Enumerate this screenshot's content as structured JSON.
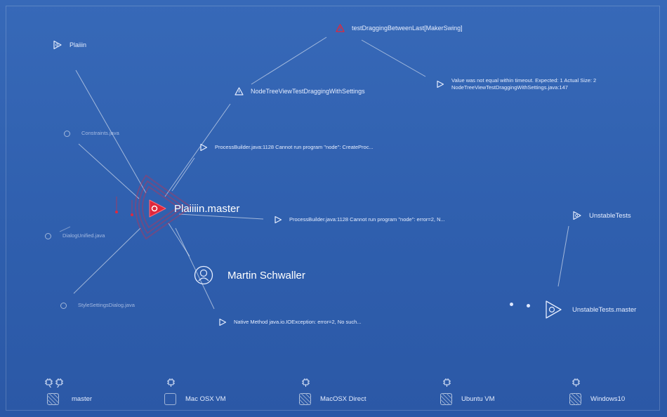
{
  "graph": {
    "nodes": {
      "plaiiiin": "Plaiiin",
      "constraints": "Constraints.java",
      "dialog_unified": "DialogUnified.java",
      "style_settings": "StyleSettingsDialog.java",
      "test_dragging_last": "testDraggingBetweenLast[MakerSwing]",
      "nodetree_settings": "NodeTreeViewTestDraggingWithSettings",
      "value_not_equal_1": "Value was not equal within timeout. Expected: 1 Actual Size:  2",
      "value_not_equal_2": "NodeTreeViewTestDraggingWithSettings.java:147",
      "processbuilder_1": "ProcessBuilder.java:1128 Cannot run program \"node\": CreateProc...",
      "master": "Plaiiiin.master",
      "processbuilder_2": "ProcessBuilder.java:1128 Cannot run program \"node\": error=2, N...",
      "user": "Martin Schwaller",
      "native_method": "Native Method java.io.IOException: error=2, No such...",
      "unstable_tests": "UnstableTests",
      "unstable_master": "UnstableTests.master"
    }
  },
  "agents": [
    {
      "label": "master"
    },
    {
      "label": "Mac OSX VM"
    },
    {
      "label": "MacOSX Direct"
    },
    {
      "label": "Ubuntu VM"
    },
    {
      "label": "Windows10"
    }
  ],
  "colors": {
    "background": "#3266b4",
    "alert_red": "#e0283c",
    "text": "#eaf1ff"
  }
}
